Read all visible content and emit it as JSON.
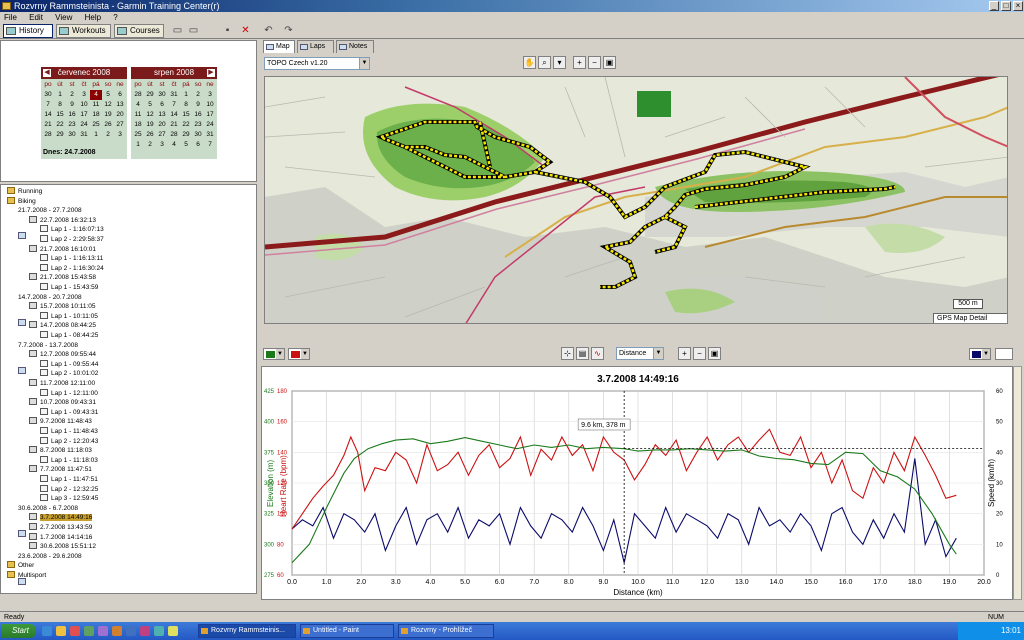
{
  "window": {
    "title": "Rozvrny Rammsteinista - Garmin Training Center(r)"
  },
  "menu": [
    "File",
    "Edit",
    "View",
    "Help",
    "?"
  ],
  "toolbar": {
    "history": "History",
    "workouts": "Workouts",
    "courses": "Courses"
  },
  "calendar": {
    "months": [
      {
        "name": "červenec 2008",
        "headers": [
          "po",
          "út",
          "st",
          "čt",
          "pá",
          "so",
          "ne"
        ],
        "days": [
          "30",
          "1",
          "2",
          "3",
          "4",
          "5",
          "6",
          "7",
          "8",
          "9",
          "10",
          "11",
          "12",
          "13",
          "14",
          "15",
          "16",
          "17",
          "18",
          "19",
          "20",
          "21",
          "22",
          "23",
          "24",
          "25",
          "26",
          "27",
          "28",
          "29",
          "30",
          "31",
          "1",
          "2",
          "3"
        ],
        "today_index": 4
      },
      {
        "name": "srpen 2008",
        "headers": [
          "po",
          "út",
          "st",
          "čt",
          "pá",
          "so",
          "ne"
        ],
        "days": [
          "28",
          "29",
          "30",
          "31",
          "1",
          "2",
          "3",
          "4",
          "5",
          "6",
          "7",
          "8",
          "9",
          "10",
          "11",
          "12",
          "13",
          "14",
          "15",
          "16",
          "17",
          "18",
          "19",
          "20",
          "21",
          "22",
          "23",
          "24",
          "25",
          "26",
          "27",
          "28",
          "29",
          "30",
          "31",
          "1",
          "2",
          "3",
          "4",
          "5",
          "6",
          "7"
        ]
      }
    ],
    "today_label": "Dnes: 24.7.2008"
  },
  "tree": [
    {
      "level": 0,
      "icon": "fold",
      "text": "Running"
    },
    {
      "level": 0,
      "icon": "fold",
      "text": "Biking"
    },
    {
      "level": 1,
      "icon": "cal",
      "text": "21.7.2008 - 27.7.2008"
    },
    {
      "level": 2,
      "icon": "act",
      "text": "22.7.2008 16:32:13"
    },
    {
      "level": 3,
      "icon": "lap",
      "text": "Lap 1 - 1:16:07:13"
    },
    {
      "level": 3,
      "icon": "lap",
      "text": "Lap 2 - 2:29:58:37"
    },
    {
      "level": 2,
      "icon": "act",
      "text": "21.7.2008 16:10:01"
    },
    {
      "level": 3,
      "icon": "lap",
      "text": "Lap 1 - 1:16:13:11"
    },
    {
      "level": 3,
      "icon": "lap",
      "text": "Lap 2 - 1:16:30:24"
    },
    {
      "level": 2,
      "icon": "act",
      "text": "21.7.2008 15:43:58"
    },
    {
      "level": 3,
      "icon": "lap",
      "text": "Lap 1 - 15:43:59"
    },
    {
      "level": 1,
      "icon": "cal",
      "text": "14.7.2008 - 20.7.2008"
    },
    {
      "level": 2,
      "icon": "act",
      "text": "15.7.2008 10:11:05"
    },
    {
      "level": 3,
      "icon": "lap",
      "text": "Lap 1 - 10:11:05"
    },
    {
      "level": 2,
      "icon": "act",
      "text": "14.7.2008 08:44:25"
    },
    {
      "level": 3,
      "icon": "lap",
      "text": "Lap 1 - 08:44:25"
    },
    {
      "level": 1,
      "icon": "cal",
      "text": "7.7.2008 - 13.7.2008"
    },
    {
      "level": 2,
      "icon": "act",
      "text": "12.7.2008 09:55:44"
    },
    {
      "level": 3,
      "icon": "lap",
      "text": "Lap 1 - 09:55:44"
    },
    {
      "level": 3,
      "icon": "lap",
      "text": "Lap 2 - 10:01:02"
    },
    {
      "level": 2,
      "icon": "act",
      "text": "11.7.2008 12:11:00"
    },
    {
      "level": 3,
      "icon": "lap",
      "text": "Lap 1 - 12:11:00"
    },
    {
      "level": 2,
      "icon": "act",
      "text": "10.7.2008 09:43:31"
    },
    {
      "level": 3,
      "icon": "lap",
      "text": "Lap 1 - 09:43:31"
    },
    {
      "level": 2,
      "icon": "act",
      "text": "9.7.2008 11:48:43"
    },
    {
      "level": 3,
      "icon": "lap",
      "text": "Lap 1 - 11:48:43"
    },
    {
      "level": 3,
      "icon": "lap",
      "text": "Lap 2 - 12:20:43"
    },
    {
      "level": 2,
      "icon": "act",
      "text": "8.7.2008 11:18:03"
    },
    {
      "level": 3,
      "icon": "lap",
      "text": "Lap 1 - 11:18:03"
    },
    {
      "level": 2,
      "icon": "act",
      "text": "7.7.2008 11:47:51"
    },
    {
      "level": 3,
      "icon": "lap",
      "text": "Lap 1 - 11:47:51"
    },
    {
      "level": 3,
      "icon": "lap",
      "text": "Lap 2 - 12:32:25"
    },
    {
      "level": 3,
      "icon": "lap",
      "text": "Lap 3 - 12:59:45"
    },
    {
      "level": 1,
      "icon": "cal",
      "text": "30.6.2008 - 6.7.2008"
    },
    {
      "level": 2,
      "icon": "act",
      "text": "3.7.2008 14:49:16",
      "selected": true
    },
    {
      "level": 2,
      "icon": "act",
      "text": "2.7.2008 13:43:59"
    },
    {
      "level": 2,
      "icon": "act",
      "text": "1.7.2008 14:14:16"
    },
    {
      "level": 2,
      "icon": "act",
      "text": "30.6.2008 15:51:12"
    },
    {
      "level": 1,
      "icon": "cal",
      "text": "23.6.2008 - 29.6.2008"
    },
    {
      "level": 0,
      "icon": "fold",
      "text": "Other"
    },
    {
      "level": 0,
      "icon": "fold",
      "text": "Multisport"
    }
  ],
  "tabs": [
    "Map",
    "Laps",
    "Notes"
  ],
  "map": {
    "combo": "TOPO Czech v1.20",
    "scale": "500 m",
    "detail": "GPS Map Detail"
  },
  "chartctrl": {
    "xaxis_mode": "Distance"
  },
  "chart_data": {
    "type": "line",
    "title": "3.7.2008 14:49:16",
    "xlabel": "Distance (km)",
    "ylabel_left1": "Elevation (m)",
    "ylabel_left2": "Heart Rate (bpm)",
    "ylabel_right": "Speed (km/h)",
    "x_ticks": [
      "0.0",
      "1.0",
      "2.0",
      "3.0",
      "4.0",
      "5.0",
      "6.0",
      "7.0",
      "8.0",
      "9.0",
      "10.0",
      "11.0",
      "12.0",
      "13.0",
      "14.0",
      "15.0",
      "16.0",
      "17.0",
      "18.0",
      "19.0",
      "20.0"
    ],
    "elev_ticks": [
      "275",
      "300",
      "325",
      "350",
      "375",
      "400",
      "425"
    ],
    "hr_ticks": [
      "60",
      "80",
      "100",
      "120",
      "140",
      "160",
      "180"
    ],
    "speed_ticks": [
      "0",
      "10",
      "20",
      "30",
      "40",
      "50",
      "60"
    ],
    "xlim": [
      0,
      20
    ],
    "elev_lim": [
      275,
      425
    ],
    "hr_lim": [
      60,
      180
    ],
    "speed_lim": [
      0,
      60
    ],
    "cursor_label": "9.6 km, 378 m",
    "cursor_x": 9.6,
    "elevation": {
      "name": "Elevation",
      "color": "#1a7a1a",
      "x": [
        0,
        0.5,
        1.0,
        1.5,
        1.8,
        2.2,
        2.6,
        3.0,
        3.5,
        4.0,
        4.5,
        5.0,
        5.5,
        6.0,
        6.5,
        7.0,
        7.5,
        8.0,
        8.5,
        9.0,
        9.6,
        10.0,
        10.5,
        11.0,
        11.5,
        12.0,
        12.5,
        13.0,
        13.5,
        14.0,
        14.5,
        15.0,
        15.5,
        16.0,
        16.5,
        17.0,
        17.5,
        18.0,
        18.5,
        19.0,
        19.2
      ],
      "y": [
        285,
        300,
        330,
        358,
        370,
        378,
        382,
        385,
        386,
        382,
        384,
        387,
        384,
        381,
        378,
        381,
        379,
        381,
        378,
        379,
        378,
        376,
        377,
        377,
        378,
        377,
        376,
        377,
        372,
        370,
        369,
        366,
        365,
        375,
        374,
        360,
        355,
        345,
        325,
        300,
        292
      ]
    },
    "heart_rate": {
      "name": "Heart Rate",
      "color": "#cc1111",
      "x": [
        0,
        0.3,
        0.6,
        0.9,
        1.2,
        1.5,
        1.7,
        1.9,
        2.1,
        2.4,
        2.7,
        3.0,
        3.3,
        3.6,
        3.9,
        4.2,
        4.5,
        4.8,
        5.1,
        5.4,
        5.7,
        6.0,
        6.3,
        6.6,
        6.9,
        7.2,
        7.5,
        7.8,
        8.1,
        8.4,
        8.7,
        9.0,
        9.3,
        9.6,
        9.9,
        10.2,
        10.5,
        10.8,
        11.1,
        11.4,
        11.7,
        12.0,
        12.3,
        12.6,
        12.9,
        13.2,
        13.5,
        13.8,
        14.1,
        14.4,
        14.7,
        15.0,
        15.3,
        15.6,
        15.9,
        16.2,
        16.5,
        16.8,
        17.1,
        17.4,
        17.7,
        18.0,
        18.3,
        18.6,
        18.9,
        19.2
      ],
      "y": [
        90,
        100,
        110,
        118,
        125,
        138,
        150,
        140,
        115,
        130,
        128,
        140,
        135,
        120,
        145,
        128,
        132,
        140,
        125,
        138,
        145,
        130,
        136,
        150,
        125,
        142,
        135,
        150,
        138,
        145,
        128,
        150,
        140,
        135,
        122,
        132,
        145,
        138,
        148,
        128,
        140,
        150,
        135,
        145,
        150,
        140,
        148,
        155,
        140,
        138,
        150,
        130,
        140,
        120,
        135,
        115,
        110,
        130,
        120,
        140,
        128,
        150,
        138,
        125,
        110,
        112
      ]
    },
    "speed": {
      "name": "Speed",
      "color": "#0a0a6a",
      "x": [
        0,
        0.3,
        0.6,
        0.9,
        1.2,
        1.5,
        1.8,
        2.1,
        2.4,
        2.7,
        3.0,
        3.3,
        3.6,
        3.9,
        4.2,
        4.5,
        4.8,
        5.1,
        5.4,
        5.7,
        6.0,
        6.3,
        6.6,
        6.9,
        7.2,
        7.5,
        7.8,
        8.1,
        8.4,
        8.7,
        9.0,
        9.3,
        9.6,
        9.9,
        10.2,
        10.5,
        10.8,
        11.1,
        11.4,
        11.7,
        12.0,
        12.3,
        12.6,
        12.9,
        13.2,
        13.5,
        13.8,
        14.1,
        14.4,
        14.7,
        15.0,
        15.3,
        15.6,
        15.9,
        16.2,
        16.5,
        16.8,
        17.1,
        17.4,
        17.7,
        18.0,
        18.3,
        18.6,
        18.9,
        19.2
      ],
      "y": [
        15,
        18,
        16,
        22,
        12,
        20,
        18,
        14,
        20,
        8,
        16,
        22,
        10,
        18,
        20,
        14,
        22,
        12,
        18,
        16,
        20,
        10,
        22,
        16,
        12,
        20,
        18,
        14,
        22,
        16,
        8,
        18,
        4,
        20,
        16,
        12,
        22,
        14,
        20,
        18,
        16,
        12,
        20,
        18,
        10,
        22,
        16,
        18,
        14,
        20,
        16,
        8,
        20,
        22,
        14,
        10,
        18,
        12,
        20,
        14,
        38,
        10,
        18,
        6,
        12
      ]
    }
  },
  "status": {
    "left": "Ready",
    "right": "NUM"
  },
  "taskbar": {
    "start": "Start",
    "tasks": [
      "Rozvrny Rammsteinis...",
      "Untitled - Paint",
      "Rozvrny - Prohlížeč"
    ],
    "clock": "13:01"
  },
  "colors": {
    "elevation": "#1a7a1a",
    "heart_rate": "#cc1111",
    "speed": "#0a0a6a",
    "track": "#f5e600"
  }
}
